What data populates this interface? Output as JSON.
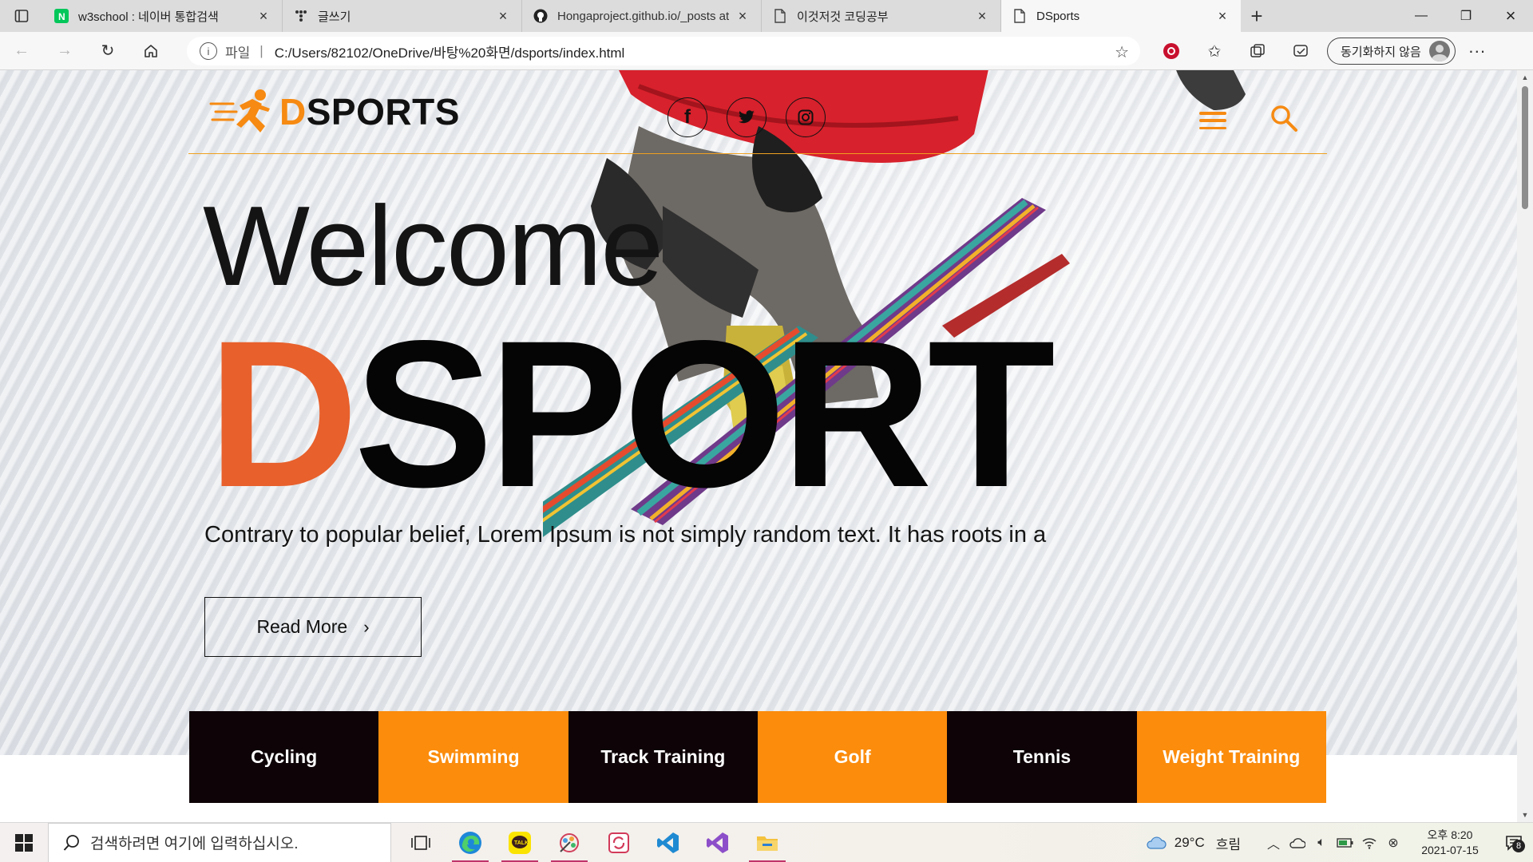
{
  "browser": {
    "tabs": [
      {
        "title": "w3school : 네이버 통합검색",
        "icon": "naver-icon",
        "active": false
      },
      {
        "title": "글쓰기",
        "icon": "tistory-icon",
        "active": false
      },
      {
        "title": "Hongaproject.github.io/_posts at",
        "icon": "github-icon",
        "active": false
      },
      {
        "title": "이것저것 코딩공부",
        "icon": "page-icon",
        "active": false
      },
      {
        "title": "DSports",
        "icon": "page-icon",
        "active": true
      }
    ],
    "address": {
      "scheme_label": "파일",
      "url": "C:/Users/82102/OneDrive/바탕%20화면/dsports/index.html"
    },
    "profile_label": "동기화하지 않음"
  },
  "site": {
    "logo": {
      "accent": "D",
      "rest": "SPORTS"
    },
    "socials": [
      {
        "label": "f",
        "name": "facebook-icon"
      },
      {
        "label": "twitter",
        "name": "twitter-icon"
      },
      {
        "label": "instagram",
        "name": "instagram-icon"
      }
    ],
    "hero": {
      "welcome": "Welcome",
      "title_accent": "D",
      "title_rest": "SPORT",
      "tagline": "Contrary to popular belief, Lorem Ipsum is not simply random text. It has roots in a",
      "cta_label": "Read More",
      "cta_chevron": "›"
    },
    "categories": [
      {
        "label": "Cycling",
        "style": "dark"
      },
      {
        "label": "Swimming",
        "style": "orange"
      },
      {
        "label": "Track Training",
        "style": "dark"
      },
      {
        "label": "Golf",
        "style": "orange"
      },
      {
        "label": "Tennis",
        "style": "dark"
      },
      {
        "label": "Weight Training",
        "style": "orange"
      }
    ],
    "colors": {
      "brand_orange": "#f68a12",
      "title_orange": "#e8602c",
      "category_orange": "#fb8c0c",
      "category_dark": "#0e0407"
    }
  },
  "taskbar": {
    "search_placeholder": "검색하려면 여기에 입력하십시오.",
    "weather": {
      "temp": "29°C",
      "condition": "흐림"
    },
    "clock": {
      "time": "오후 8:20",
      "date": "2021-07-15"
    },
    "notifications": "8"
  }
}
